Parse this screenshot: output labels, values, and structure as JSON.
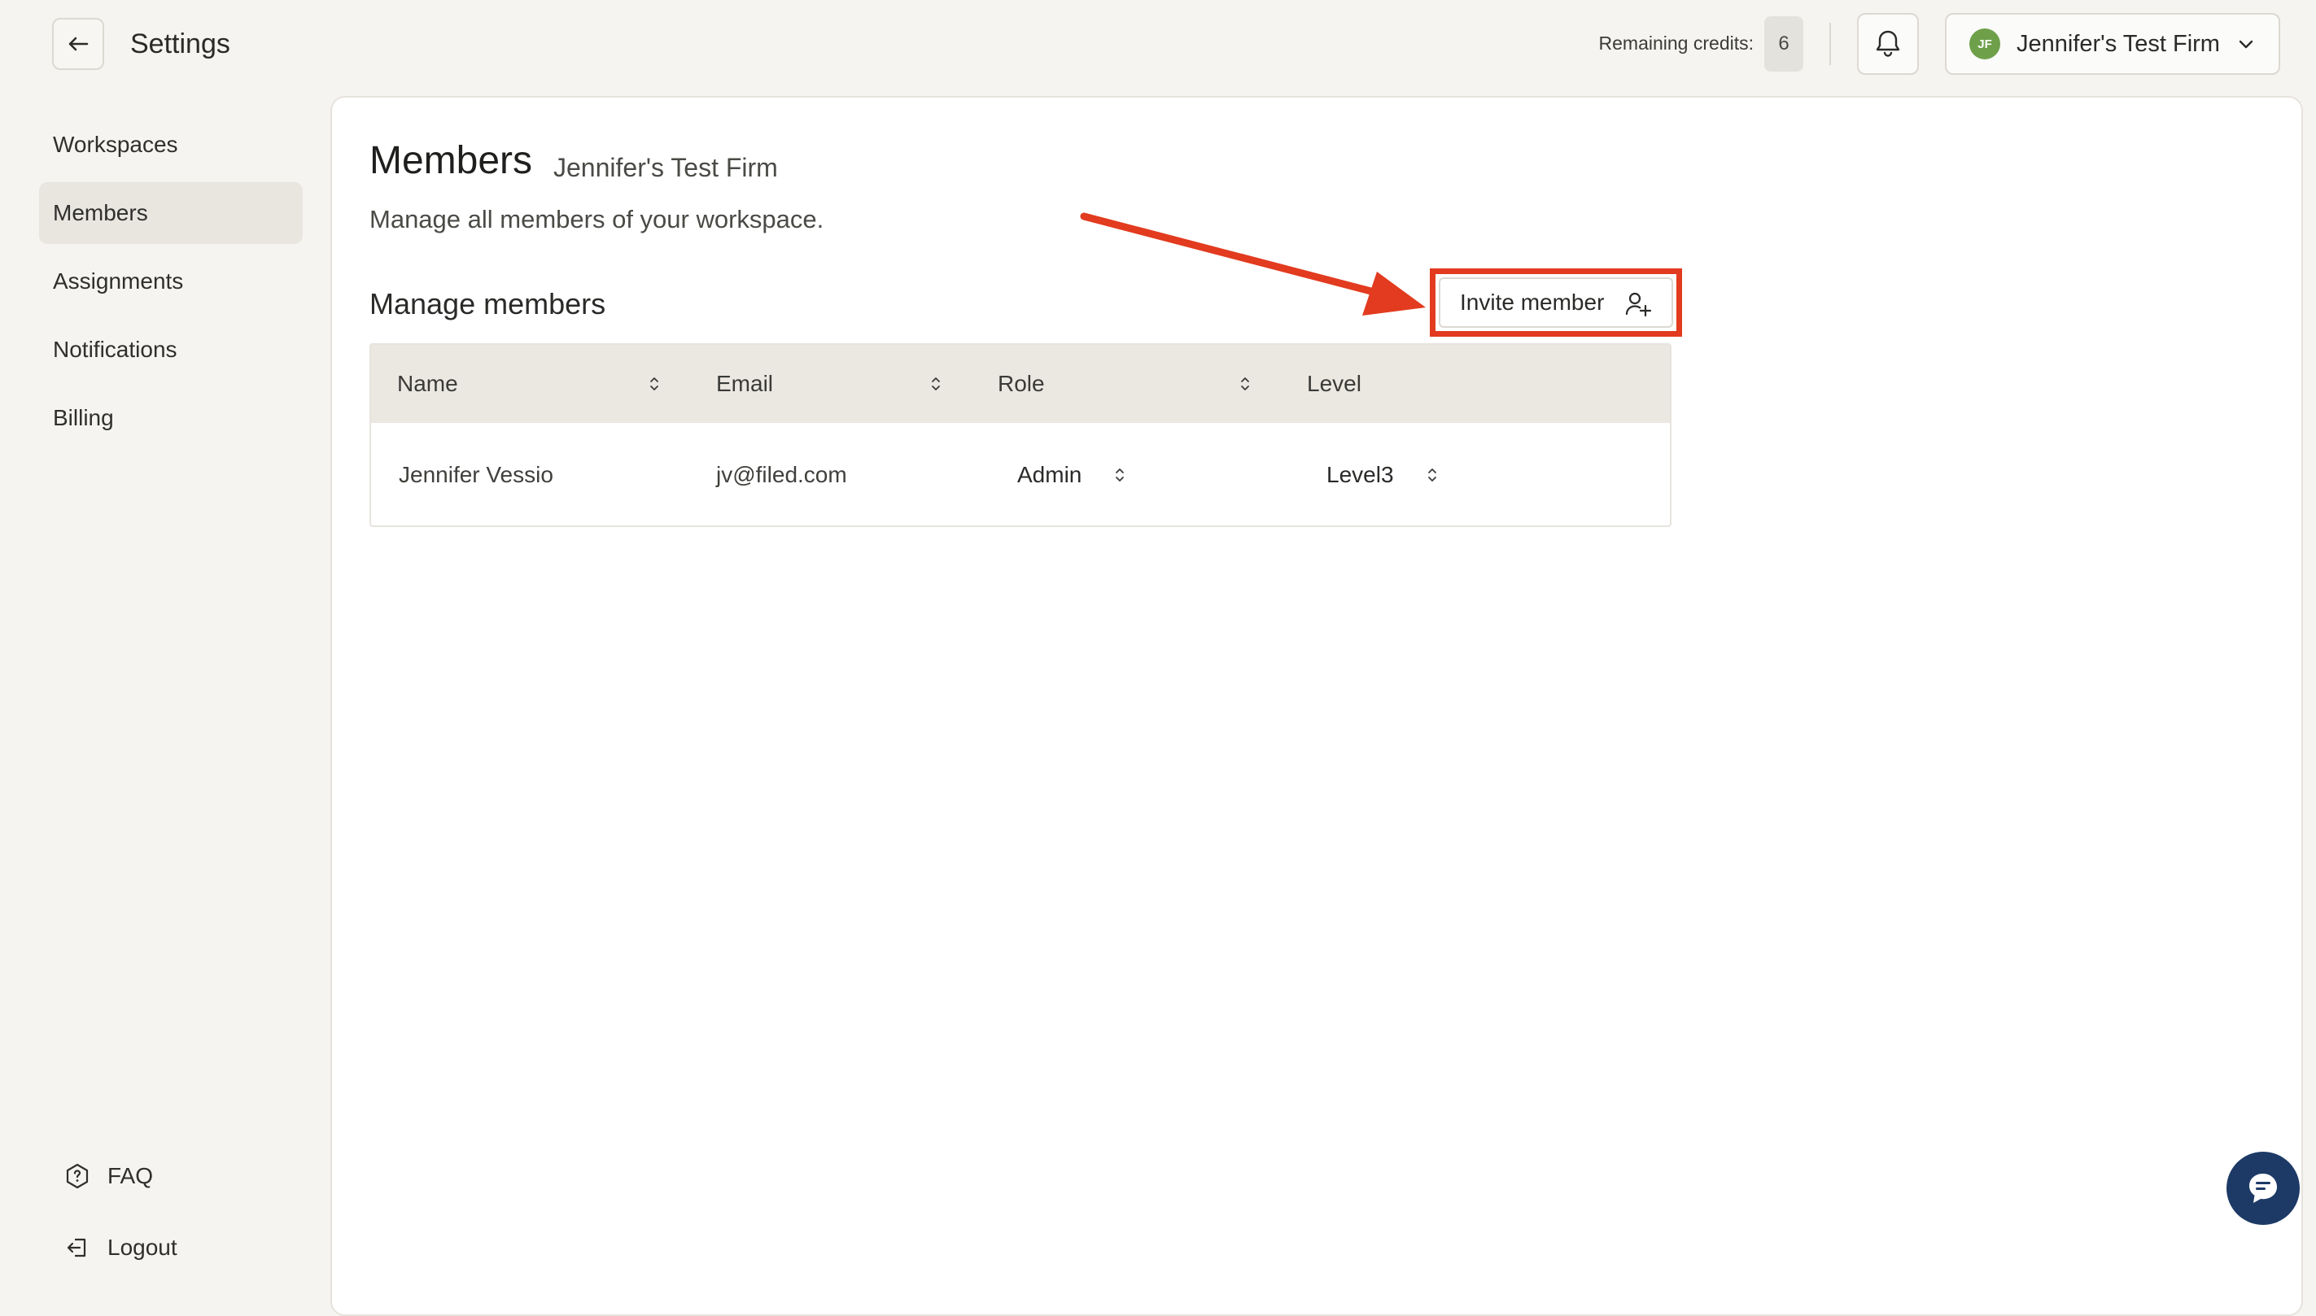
{
  "header": {
    "title": "Settings",
    "credits_label": "Remaining credits:",
    "credits_value": "6",
    "firm_initials": "JF",
    "firm_name": "Jennifer's Test Firm"
  },
  "sidebar": {
    "items": [
      {
        "label": "Workspaces",
        "active": false
      },
      {
        "label": "Members",
        "active": true
      },
      {
        "label": "Assignments",
        "active": false
      },
      {
        "label": "Notifications",
        "active": false
      },
      {
        "label": "Billing",
        "active": false
      }
    ],
    "faq_label": "FAQ",
    "logout_label": "Logout"
  },
  "main": {
    "title": "Members",
    "subtitle": "Jennifer's Test Firm",
    "description": "Manage all members of your workspace.",
    "section_title": "Manage members",
    "invite_label": "Invite member",
    "table": {
      "columns": [
        "Name",
        "Email",
        "Role",
        "Level"
      ],
      "rows": [
        {
          "name": "Jennifer Vessio",
          "email": "jv@filed.com",
          "role": "Admin",
          "level": "Level3"
        }
      ]
    }
  },
  "colors": {
    "background": "#f5f4f1",
    "panel": "#ffffff",
    "table_header": "#ebe8e2",
    "annotation": "#e23b1f",
    "avatar": "#6ea04a",
    "chat": "#1d3a66"
  }
}
